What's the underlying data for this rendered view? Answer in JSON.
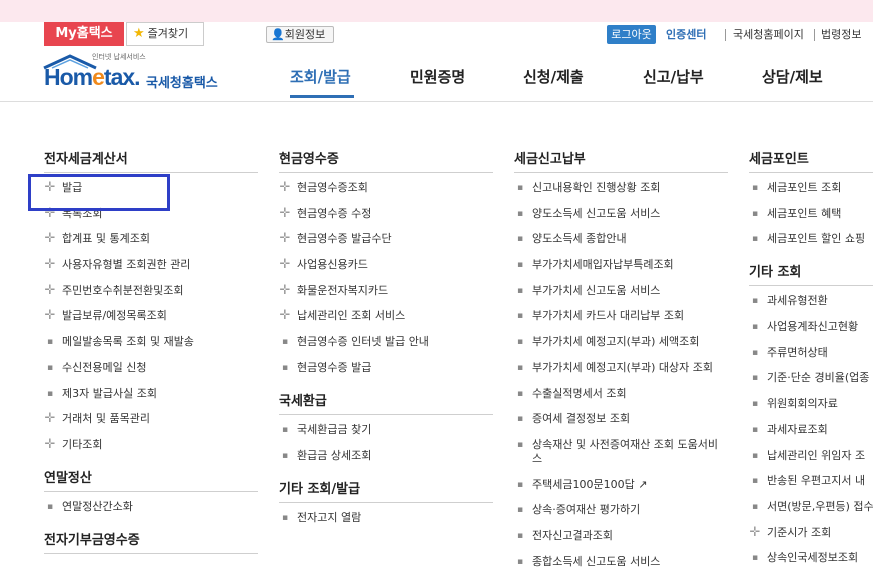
{
  "topbar": {
    "my_hometax": "My홈택스",
    "favorites": "즐겨찾기",
    "member_info": "회원정보",
    "logout": "로그아웃",
    "cert_center": "인증센터",
    "nts_page": "국세청홈페이지",
    "law_info": "법령정보"
  },
  "logo": {
    "small_text": "인터넷 납세서비스",
    "wordmark_pre": "Hom",
    "wordmark_e": "e",
    "wordmark_post": "tax.",
    "korean": "국세청홈택스"
  },
  "nav": {
    "items": [
      "조회/발급",
      "민원증명",
      "신청/제출",
      "신고/납부",
      "상담/제보"
    ],
    "active_index": 0
  },
  "columns": [
    {
      "sections": [
        {
          "title": "전자세금계산서",
          "items": [
            {
              "label": "발급",
              "marker": "plus"
            },
            {
              "label": "목록조회",
              "marker": "plus"
            },
            {
              "label": "합계표 및 통계조회",
              "marker": "plus"
            },
            {
              "label": "사용자유형별 조회권한 관리",
              "marker": "plus"
            },
            {
              "label": "주민번호수취분전환및조회",
              "marker": "plus"
            },
            {
              "label": "발급보류/예정목록조회",
              "marker": "plus"
            },
            {
              "label": "메일발송목록 조회 및 재발송",
              "marker": "bullet"
            },
            {
              "label": "수신전용메일 신청",
              "marker": "bullet"
            },
            {
              "label": "제3자 발급사실 조회",
              "marker": "bullet"
            },
            {
              "label": "거래처 및 품목관리",
              "marker": "plus"
            },
            {
              "label": "기타조회",
              "marker": "plus"
            }
          ]
        },
        {
          "title": "연말정산",
          "items": [
            {
              "label": "연말정산간소화",
              "marker": "bullet"
            }
          ]
        },
        {
          "title": "전자기부금영수증",
          "items": []
        }
      ]
    },
    {
      "sections": [
        {
          "title": "현금영수증",
          "items": [
            {
              "label": "현금영수증조회",
              "marker": "plus"
            },
            {
              "label": "현금영수증 수정",
              "marker": "plus"
            },
            {
              "label": "현금영수증 발급수단",
              "marker": "plus"
            },
            {
              "label": "사업용신용카드",
              "marker": "plus"
            },
            {
              "label": "화물운전자복지카드",
              "marker": "plus"
            },
            {
              "label": "납세관리인 조회 서비스",
              "marker": "plus"
            },
            {
              "label": "현금영수증 인터넷 발급 안내",
              "marker": "bullet"
            },
            {
              "label": "현금영수증 발급",
              "marker": "bullet"
            }
          ]
        },
        {
          "title": "국세환급",
          "items": [
            {
              "label": "국세환급금 찾기",
              "marker": "bullet"
            },
            {
              "label": "환급금 상세조회",
              "marker": "bullet"
            }
          ]
        },
        {
          "title": "기타 조회/발급",
          "items": [
            {
              "label": "전자고지 열람",
              "marker": "bullet"
            }
          ]
        }
      ]
    },
    {
      "sections": [
        {
          "title": "세금신고납부",
          "items": [
            {
              "label": "신고내용확인 진행상황 조회",
              "marker": "bullet"
            },
            {
              "label": "양도소득세 신고도움 서비스",
              "marker": "bullet"
            },
            {
              "label": "양도소득세 종합안내",
              "marker": "bullet"
            },
            {
              "label": "부가가치세매입자납부특례조회",
              "marker": "bullet"
            },
            {
              "label": "부가가치세 신고도움 서비스",
              "marker": "bullet"
            },
            {
              "label": "부가가치세 카드사 대리납부 조회",
              "marker": "bullet"
            },
            {
              "label": "부가가치세 예정고지(부과) 세액조회",
              "marker": "bullet"
            },
            {
              "label": "부가가치세 예정고지(부과) 대상자 조회",
              "marker": "bullet"
            },
            {
              "label": "수출실적명세서 조회",
              "marker": "bullet"
            },
            {
              "label": "증여세 결정정보 조회",
              "marker": "bullet"
            },
            {
              "label": "상속재산 및 사전증여재산 조회 도움서비스",
              "marker": "bullet"
            },
            {
              "label": "주택세금100문100답",
              "marker": "bullet"
            },
            {
              "label": "상속·증여재산 평가하기",
              "marker": "bullet"
            },
            {
              "label": "전자신고결과조회",
              "marker": "bullet"
            },
            {
              "label": "종합소득세 신고도움 서비스",
              "marker": "bullet"
            }
          ]
        }
      ]
    },
    {
      "sections": [
        {
          "title": "세금포인트",
          "items": [
            {
              "label": "세금포인트 조회",
              "marker": "bullet"
            },
            {
              "label": "세금포인트 혜택",
              "marker": "bullet"
            },
            {
              "label": "세금포인트 할인 쇼핑",
              "marker": "bullet"
            }
          ]
        },
        {
          "title": "기타 조회",
          "items": [
            {
              "label": "과세유형전환",
              "marker": "bullet"
            },
            {
              "label": "사업용계좌신고현황",
              "marker": "bullet"
            },
            {
              "label": "주류면허상태",
              "marker": "bullet"
            },
            {
              "label": "기준·단순 경비율(업종",
              "marker": "bullet"
            },
            {
              "label": "위원회회의자료",
              "marker": "bullet"
            },
            {
              "label": "과세자료조회",
              "marker": "bullet"
            },
            {
              "label": "납세관리인 위임자 조",
              "marker": "bullet"
            },
            {
              "label": "반송된 우편고지서 내",
              "marker": "bullet"
            },
            {
              "label": "서면(방문,우편등) 접수",
              "marker": "bullet"
            },
            {
              "label": "기준시가 조회",
              "marker": "plus"
            },
            {
              "label": "상속인국세정보조회",
              "marker": "bullet"
            }
          ]
        }
      ]
    }
  ]
}
